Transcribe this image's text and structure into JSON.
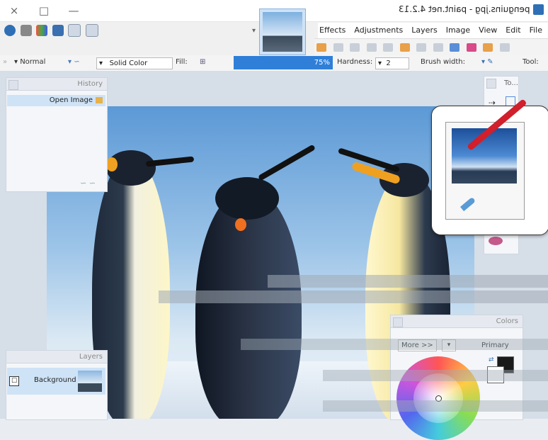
{
  "window": {
    "title": "penguins.jpg - paint.net 4.2.13",
    "controls": [
      "×",
      "□",
      "—"
    ]
  },
  "menu": [
    "File",
    "Edit",
    "View",
    "Image",
    "Layers",
    "Adjustments",
    "Effects"
  ],
  "toolbar": {
    "tool_label": "Tool:",
    "brush_width_label": "Brush width:",
    "brush_width_value": "2",
    "hardness_label": "Hardness:",
    "hardness_value": "75%",
    "fill_label": "Fill:",
    "fill_value": "Solid Color",
    "blend_value": "Normal"
  },
  "history": {
    "title": "History",
    "items": [
      "Open Image"
    ]
  },
  "layers": {
    "title": "Layers",
    "items": [
      "Background"
    ]
  },
  "tools": {
    "title": "To..."
  },
  "colors": {
    "title": "Colors",
    "mode": "Primary",
    "more_label": "More >>",
    "primary": "#1a1a1a",
    "secondary": "#ffffff"
  }
}
